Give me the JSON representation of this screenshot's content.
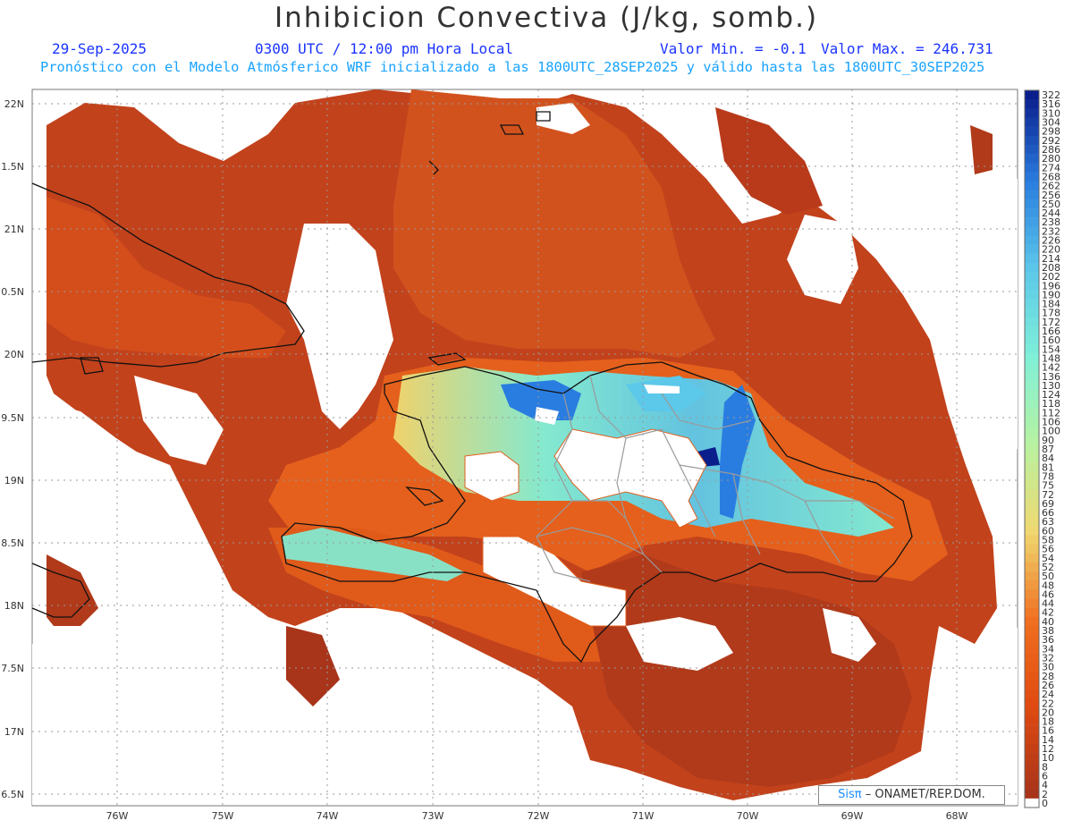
{
  "header": {
    "title": "Inhibicion Convectiva (J/kg, somb.)",
    "date": "29-Sep-2025",
    "time": "0300 UTC / 12:00 pm Hora Local",
    "valor_min": "Valor Min. = -0.1",
    "valor_max": "Valor Max. = 246.731",
    "subtitle": "Pronóstico con el Modelo Atmósferico WRF inicializado a las 1800UTC_28SEP2025 y válido hasta las  1800UTC_30SEP2025"
  },
  "credit": {
    "logo": "Sisπ",
    "text": "– ONAMET/REP.DOM."
  },
  "map": {
    "lon_labels": [
      "76W",
      "75W",
      "74W",
      "73W",
      "72W",
      "71W",
      "70W",
      "69W",
      "68W"
    ],
    "lat_labels": [
      "22N",
      "1.5N",
      "21N",
      "0.5N",
      "20N",
      "9.5N",
      "19N",
      "8.5N",
      "18N",
      "7.5N",
      "17N",
      "6.5N"
    ]
  },
  "colorbar": {
    "labels": [
      "322",
      "316",
      "310",
      "304",
      "298",
      "292",
      "286",
      "280",
      "274",
      "268",
      "262",
      "256",
      "250",
      "244",
      "238",
      "232",
      "226",
      "220",
      "214",
      "208",
      "202",
      "196",
      "190",
      "184",
      "178",
      "172",
      "166",
      "160",
      "154",
      "148",
      "142",
      "136",
      "130",
      "124",
      "118",
      "112",
      "106",
      "100",
      "90",
      "87",
      "84",
      "81",
      "78",
      "75",
      "72",
      "69",
      "66",
      "63",
      "60",
      "58",
      "56",
      "54",
      "52",
      "50",
      "48",
      "46",
      "44",
      "42",
      "40",
      "38",
      "36",
      "34",
      "32",
      "30",
      "28",
      "26",
      "24",
      "22",
      "20",
      "18",
      "16",
      "14",
      "12",
      "10",
      "8",
      "6",
      "4",
      "2",
      "0"
    ],
    "colors": {
      "high_dark_blue": "#0a1e8c",
      "mid_blue": "#2a7de0",
      "cyan": "#5cc8ea",
      "aqua": "#7ff0d8",
      "light_green": "#b8f2a0",
      "yellow": "#f0d870",
      "orange": "#f07020",
      "red_orange": "#e04a10",
      "dark_red": "#a8341a",
      "zero": "#ffffff"
    }
  }
}
